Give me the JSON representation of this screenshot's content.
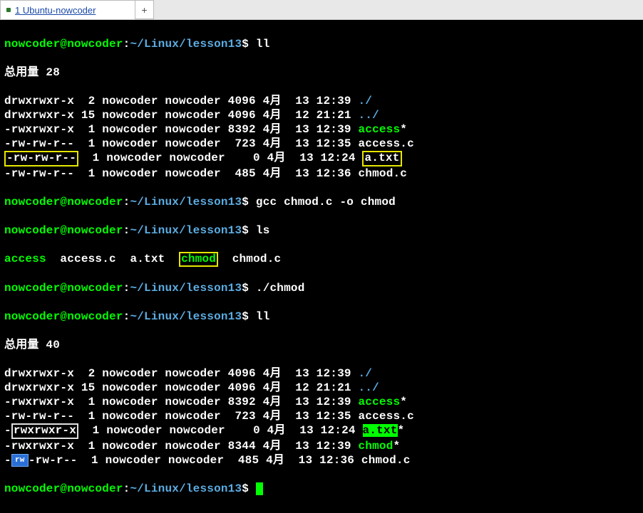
{
  "tab": {
    "title": "1 Ubuntu-nowcoder",
    "add": "+"
  },
  "prompt": {
    "user_host": "nowcoder@nowcoder",
    "path": "~/Linux/lesson13",
    "sep1": ":",
    "sep2": "$ "
  },
  "cmds": {
    "ll1": "ll",
    "gcc": "gcc chmod.c -o chmod",
    "ls": "ls",
    "run": "./chmod",
    "ll2": "ll"
  },
  "total1": "总用量 28",
  "total2": "总用量 40",
  "ls_out": {
    "access": "access",
    "accessc": "access.c",
    "atxt": "a.txt",
    "chmod": "chmod",
    "chmodc": "chmod.c"
  },
  "rows1": [
    {
      "perm": "drwxrwxr-x",
      "links": " 2",
      "own": "nowcoder",
      "grp": "nowcoder",
      "size": "4096",
      "mon": "4月",
      "day": "13",
      "time": "12:39",
      "name": "./",
      "cls": "blue"
    },
    {
      "perm": "drwxrwxr-x",
      "links": "15",
      "own": "nowcoder",
      "grp": "nowcoder",
      "size": "4096",
      "mon": "4月",
      "day": "12",
      "time": "21:21",
      "name": "../",
      "cls": "blue"
    },
    {
      "perm": "-rwxrwxr-x",
      "links": " 1",
      "own": "nowcoder",
      "grp": "nowcoder",
      "size": "8392",
      "mon": "4月",
      "day": "13",
      "time": "12:39",
      "name": "access",
      "suffix": "*",
      "cls": "green"
    },
    {
      "perm": "-rw-rw-r--",
      "links": " 1",
      "own": "nowcoder",
      "grp": "nowcoder",
      "size": " 723",
      "mon": "4月",
      "day": "13",
      "time": "12:35",
      "name": "access.c",
      "cls": "white"
    },
    {
      "perm": "-rw-rw-r--",
      "links": " 1",
      "own": "nowcoder",
      "grp": "nowcoder",
      "size": "   0",
      "mon": "4月",
      "day": "13",
      "time": "12:24",
      "name": "a.txt",
      "cls": "white",
      "box_perm": "yellow",
      "box_name": "yellow"
    },
    {
      "perm": "-rw-rw-r--",
      "links": " 1",
      "own": "nowcoder",
      "grp": "nowcoder",
      "size": " 485",
      "mon": "4月",
      "day": "13",
      "time": "12:36",
      "name": "chmod.c",
      "cls": "white"
    }
  ],
  "rows2": [
    {
      "perm": "drwxrwxr-x",
      "links": " 2",
      "own": "nowcoder",
      "grp": "nowcoder",
      "size": "4096",
      "mon": "4月",
      "day": "13",
      "time": "12:39",
      "name": "./",
      "cls": "blue"
    },
    {
      "perm": "drwxrwxr-x",
      "links": "15",
      "own": "nowcoder",
      "grp": "nowcoder",
      "size": "4096",
      "mon": "4月",
      "day": "12",
      "time": "21:21",
      "name": "../",
      "cls": "blue"
    },
    {
      "perm": "-rwxrwxr-x",
      "links": " 1",
      "own": "nowcoder",
      "grp": "nowcoder",
      "size": "8392",
      "mon": "4月",
      "day": "13",
      "time": "12:39",
      "name": "access",
      "suffix": "*",
      "cls": "green"
    },
    {
      "perm": "-rw-rw-r--",
      "links": " 1",
      "own": "nowcoder",
      "grp": "nowcoder",
      "size": " 723",
      "mon": "4月",
      "day": "13",
      "time": "12:35",
      "name": "access.c",
      "cls": "white"
    },
    {
      "perm": "rwxrwxr-x",
      "dash": "-",
      "links": " 1",
      "own": "nowcoder",
      "grp": "nowcoder",
      "size": "   0",
      "mon": "4月",
      "day": "13",
      "time": "12:24",
      "name": "a.txt",
      "suffix": "*",
      "cls": "exec-hl",
      "box_perm": "white"
    },
    {
      "perm": "-rwxrwxr-x",
      "links": " 1",
      "own": "nowcoder",
      "grp": "nowcoder",
      "size": "8344",
      "mon": "4月",
      "day": "13",
      "time": "12:39",
      "name": "chmod",
      "suffix": "*",
      "cls": "green"
    },
    {
      "perm": "-rw-r--",
      "badge": true,
      "links": " 1",
      "own": "nowcoder",
      "grp": "nowcoder",
      "size": " 485",
      "mon": "4月",
      "day": "13",
      "time": "12:36",
      "name": "chmod.c",
      "cls": "white"
    }
  ]
}
